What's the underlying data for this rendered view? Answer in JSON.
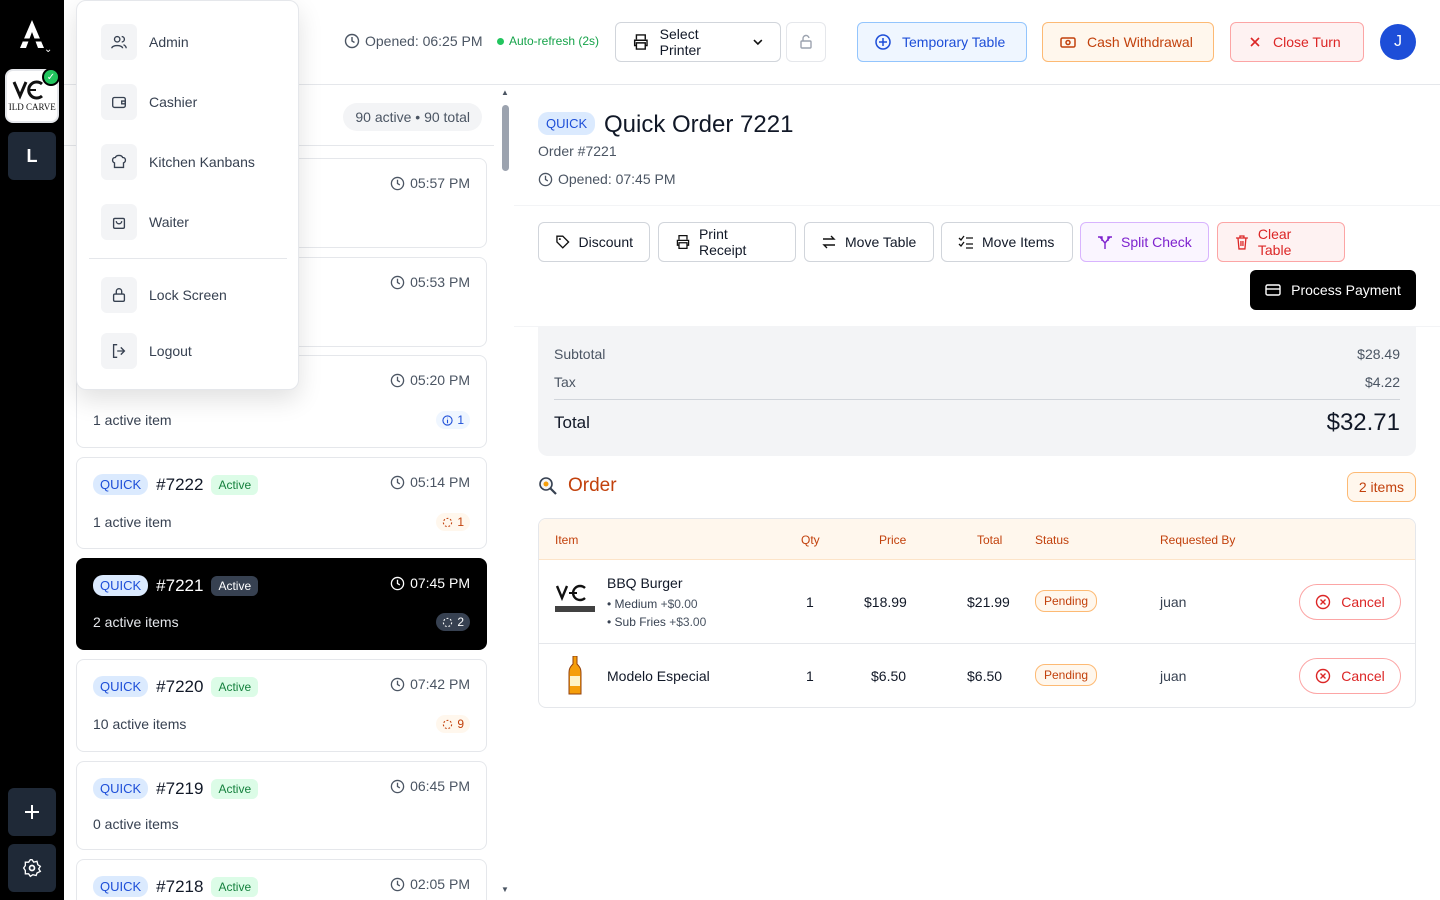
{
  "topbar": {
    "opened": "Opened: 06:25 PM",
    "autorefresh": "Auto-refresh (2s)",
    "printer_label": "Select Printer",
    "temp_table": "Temporary Table",
    "cash_withdrawal": "Cash Withdrawal",
    "close_turn": "Close Turn",
    "avatar_initial": "J"
  },
  "rail": {
    "location_initial": "L",
    "brand_text": "VILD CARVER"
  },
  "menu": {
    "items": [
      {
        "label": "Admin",
        "icon": "users-icon"
      },
      {
        "label": "Cashier",
        "icon": "wallet-icon"
      },
      {
        "label": "Kitchen Kanbans",
        "icon": "chef-hat-icon"
      },
      {
        "label": "Waiter",
        "icon": "shopping-bag-icon"
      }
    ],
    "lock_screen": "Lock Screen",
    "logout": "Logout"
  },
  "list": {
    "count_label": "90 active • 90 total",
    "orders": [
      {
        "time": "05:57 PM"
      },
      {
        "time": "05:53 PM"
      },
      {
        "time": "05:20 PM",
        "sub": "1 active item",
        "count": "1",
        "count_style": "blue"
      },
      {
        "badge": "QUICK",
        "num": "#7222",
        "status": "Active",
        "time": "05:14 PM",
        "sub": "1 active item",
        "count": "1",
        "count_style": "amber"
      },
      {
        "badge": "QUICK",
        "num": "#7221",
        "status": "Active",
        "time": "07:45 PM",
        "sub": "2 active items",
        "count": "2",
        "count_style": "dark"
      },
      {
        "badge": "QUICK",
        "num": "#7220",
        "status": "Active",
        "time": "07:42 PM",
        "sub": "10 active items",
        "count": "9",
        "count_style": "amber"
      },
      {
        "badge": "QUICK",
        "num": "#7219",
        "status": "Active",
        "time": "06:45 PM",
        "sub": "0 active items"
      },
      {
        "badge": "QUICK",
        "num": "#7218",
        "status": "Active",
        "time": "02:05 PM"
      }
    ]
  },
  "detail": {
    "badge": "QUICK",
    "title": "Quick Order 7221",
    "order_number": "Order #7221",
    "opened": "Opened: 07:45 PM",
    "actions": {
      "discount": "Discount",
      "print_receipt": "Print Receipt",
      "move_table": "Move Table",
      "move_items": "Move Items",
      "split_check": "Split Check",
      "clear_table": "Clear Table",
      "process_payment": "Process Payment"
    },
    "totals": {
      "subtotal_label": "Subtotal",
      "subtotal": "$28.49",
      "tax_label": "Tax",
      "tax": "$4.22",
      "total_label": "Total",
      "total": "$32.71"
    },
    "order_section": {
      "title": "Order",
      "items_count": "2 items",
      "columns": [
        "Item",
        "Qty",
        "Price",
        "Total",
        "Status",
        "Requested By"
      ],
      "rows": [
        {
          "name": "BBQ Burger",
          "modifiers": [
            "• Medium",
            "+$0.00",
            "• Sub Fries",
            "+$3.00"
          ],
          "qty": "1",
          "price": "$18.99",
          "total": "$21.99",
          "status": "Pending",
          "requested_by": "juan",
          "cancel": "Cancel"
        },
        {
          "name": "Modelo Especial",
          "qty": "1",
          "price": "$6.50",
          "total": "$6.50",
          "status": "Pending",
          "requested_by": "juan",
          "cancel": "Cancel"
        }
      ]
    }
  }
}
